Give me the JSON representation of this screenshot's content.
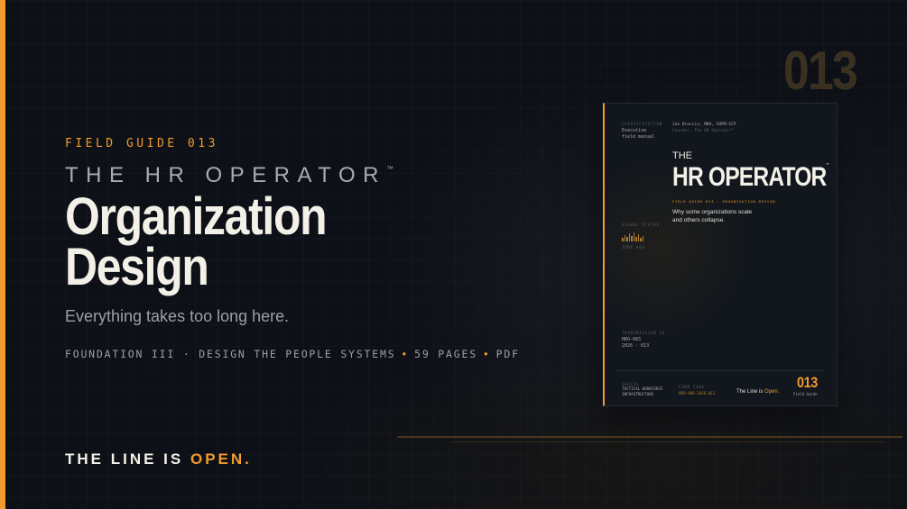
{
  "hero": {
    "kicker": "FIELD GUIDE 013",
    "series": "THE HR OPERATOR",
    "series_mark": "™",
    "title_line1": "Organization",
    "title_line2": "Design",
    "subtitle": "Everything takes too long here.",
    "meta_part1": "FOUNDATION III · DESIGN THE PEOPLE SYSTEMS",
    "meta_part2": "59 PAGES",
    "meta_part3": "PDF",
    "meta_sep": "•"
  },
  "tagline": {
    "text": "THE LINE IS",
    "highlight": "OPEN."
  },
  "big_number": "013",
  "book": {
    "classification_label": "CLASSIFICATION",
    "classification_line1": "Executive",
    "classification_line2": "field manual",
    "author_name": "Joe Braccio, MBA, SHRM-SCP",
    "author_role": "Founder, The HR Operator™",
    "the": "THE",
    "title": "HR OPERATOR",
    "title_mark": "™",
    "field_guide": "FIELD GUIDE 013 · ORGANIZATION DESIGN",
    "tag_line1": "Why some organizations scale",
    "tag_line2": "and others collapse.",
    "signal_label": "SIGNAL STATUS",
    "signal_value": "ZONE 004",
    "transmission_label": "TRANSMISSION ID",
    "transmission_line1": "HRO-083",
    "transmission_line2": "2026 · 013",
    "series_label": "SERIES",
    "series_line1": "TACTICAL WORKFORCE",
    "series_line2": "INFRASTRUCTURE",
    "form_label": "FORM CODE",
    "form_value": "HRO-086-2026-013",
    "line_text": "The Line is",
    "line_highlight": "Open.",
    "number": "013",
    "number_sub": "Field Guide"
  },
  "colors": {
    "accent": "#f29a2e",
    "background": "#0d1117",
    "text": "#f3f0e8"
  }
}
